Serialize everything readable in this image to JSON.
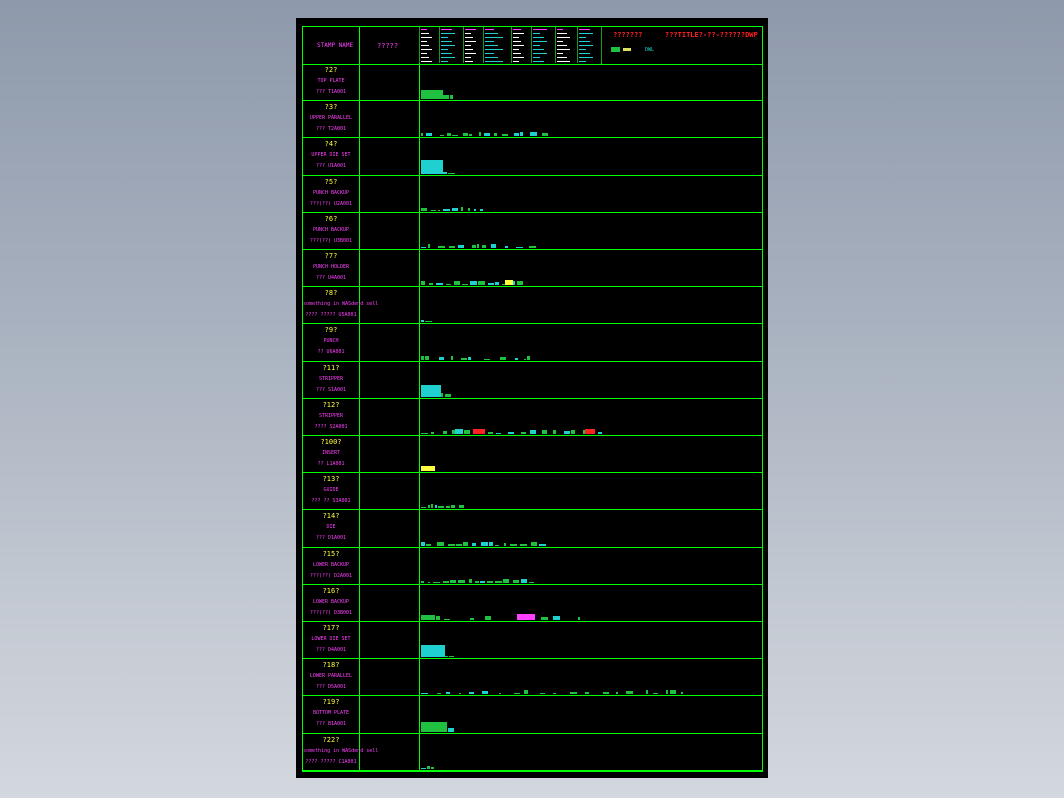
{
  "header": {
    "stamp_label": "STAMP NAME",
    "qty_label": "?????",
    "red_left": "???????",
    "red_right": "???TITLE?-??-??????DWP",
    "legend_small": "DWL",
    "mini_table_rows": 9
  },
  "rows": [
    {
      "num": "?2?",
      "name": "TOP PLATE",
      "spec": "??? T1A001"
    },
    {
      "num": "?3?",
      "name": "UPPER PARALLEL",
      "spec": "??? T2A001"
    },
    {
      "num": "?4?",
      "name": "UPPER DIE SET",
      "spec": "??? U1A001"
    },
    {
      "num": "?5?",
      "name": "PUNCH BACKUP",
      "spec": "???(??) U2A001"
    },
    {
      "num": "?6?",
      "name": "PUNCH BACKUP",
      "spec": "???(??) U3B001"
    },
    {
      "num": "?7?",
      "name": "PUNCH HOLDER",
      "spec": "??? U4A001"
    },
    {
      "num": "?8?",
      "name": "something in WASdend sell",
      "spec": "???? ????? U5A001"
    },
    {
      "num": "?9?",
      "name": "PUNCH",
      "spec": "?? U6A001"
    },
    {
      "num": "?11?",
      "name": "STRIPPER",
      "spec": "??? S1A001"
    },
    {
      "num": "?12?",
      "name": "STRIPPER",
      "spec": "???? S2A001"
    },
    {
      "num": "?100?",
      "name": "INSERT",
      "spec": "?? L1A001"
    },
    {
      "num": "?13?",
      "name": "GUIDE",
      "spec": "??? ?? S3A001"
    },
    {
      "num": "?14?",
      "name": "DIE",
      "spec": "??? D1A001"
    },
    {
      "num": "?15?",
      "name": "LOWER BACKUP",
      "spec": "???(??) D2A001"
    },
    {
      "num": "?16?",
      "name": "LOWER BACKUP",
      "spec": "???(??) D3B001"
    },
    {
      "num": "?17?",
      "name": "LOWER DIE SET",
      "spec": "??? D4A001"
    },
    {
      "num": "?18?",
      "name": "LOWER PARALLEL",
      "spec": "??? D5A001"
    },
    {
      "num": "?19?",
      "name": "BOTTOM PLATE",
      "spec": "??? B1A001"
    },
    {
      "num": "?22?",
      "name": "something in WASdend sell",
      "spec": "???? ????? C1A001"
    }
  ],
  "colors": {
    "grid": "#00ff00",
    "number": "#ffff40",
    "label": "#ff40ff",
    "title": "#ff2020",
    "part_green": "#20c040",
    "part_cyan": "#20d0d0",
    "part_red": "#ff2020",
    "part_magenta": "#ff40ff",
    "part_yellow": "#ffff40"
  }
}
